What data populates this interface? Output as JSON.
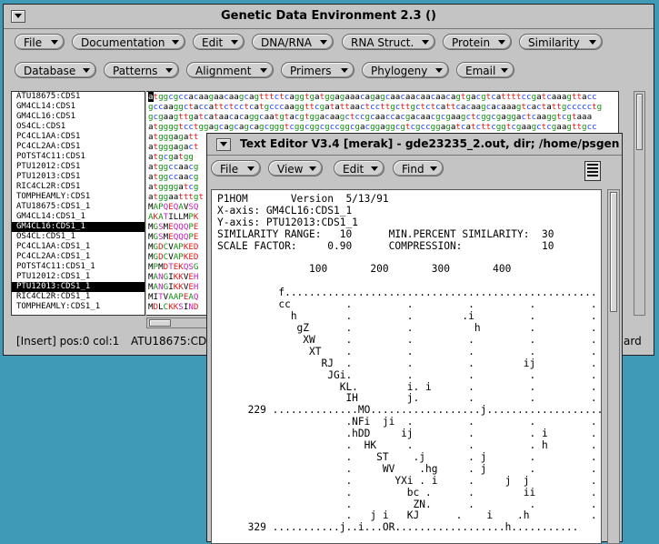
{
  "main_window": {
    "title": "Genetic Data Environment 2.3 ()",
    "menu_row1": [
      "File",
      "Documentation",
      "Edit",
      "DNA/RNA",
      "RNA Struct.",
      "Protein",
      "Similarity"
    ],
    "menu_row2": [
      "Database",
      "Patterns",
      "Alignment",
      "Primers",
      "Phylogeny",
      "Email"
    ],
    "sequence_names": [
      "ATU18675:CDS1",
      "GM4CL14:CDS1",
      "GM4CL16:CDS1",
      "OS4CL:CDS1",
      "PC4CL1AA:CDS1",
      "PC4CL2AA:CDS1",
      "POTST4C11:CDS1",
      "PTU12012:CDS1",
      "PTU12013:CDS1",
      "RIC4CL2R:CDS1",
      "TOMPHEAMLY:CDS1",
      "ATU18675:CDS1_1",
      "GM4CL14:CDS1_1",
      "GM4CL16:CDS1_1",
      "OS4CL:CDS1_1",
      "PC4CL1AA:CDS1_1",
      "PC4CL2AA:CDS1_1",
      "POTST4C11:CDS1_1",
      "PTU12012:CDS1_1",
      "PTU12013:CDS1_1",
      "RIC4CL2R:CDS1_1",
      "TOMPHEAMLY:CDS1_1"
    ],
    "selected_indices": [
      13,
      19
    ],
    "sequences": [
      "atggcgccacaagaacaagcagtttctcaggtgatggagaaacagagcaacaacaacaacagtgacgtcattttccgatcaaagttacc",
      "gccaaggctaccattctcctcatgcccaaggttcgatattaactccttgcttgctctcattcacaagcacaaagtcactattgccccctg",
      "gcgaagttgatcataacacaggcaatgtacgtggacaagctccgcaaccacgacaacgcgaagctcggcgaggactcaaggtcgtaaa",
      "atggggtcctggagcagcagcagcgggtcggcggcgccggcgacggaggcgtcgccggagatcatcttcggtcgaagctcgaagttgcc",
      "atgggagatt",
      "atgggagact",
      "atgcgatgg",
      "atggccaacg",
      "atggccaacg",
      "atggggatcg",
      "atggaatttgt",
      "MAPQEQAVSQ",
      "AKATILLMPK",
      "MGSMEQQQPE",
      "MGSMEQQQPE",
      "MGDCVAPKED",
      "MGDCVAPKED",
      "MPMDTEKQSG",
      "MANGIKKVEH",
      "MANGIKKVEH",
      "MITVAAPEAQ",
      "MDLCKKSIND"
    ],
    "status_left": "[Insert] pos:0 col:1",
    "status_seq": "ATU18675:CD",
    "status_right": "ard"
  },
  "colors": {
    "desktop": "#3f9ab8",
    "a": "#000000",
    "c": "#1a3cff",
    "g": "#109010",
    "t": "#e01818",
    "protein_red": "#e01818",
    "protein_purple": "#c020c0",
    "protein_green": "#109010",
    "protein_black": "#000000"
  },
  "editor": {
    "title": "Text Editor V3.4 [merak]  - gde23235_2.out, dir; /home/psgen",
    "menus": [
      "File",
      "View",
      "Edit",
      "Find"
    ],
    "lines": [
      "P1HOM       Version  5/13/91",
      "X-axis: GM4CL16:CDS1_1",
      "Y-axis: PTU12013:CDS1_1",
      "SIMILARITY RANGE:   10      MIN.PERCENT SIMILARITY:  30",
      "SCALE FACTOR:     0.90      COMPRESSION:             10",
      "",
      "               100       200       300       400",
      "",
      "          f...................................................",
      "          cc         .         .         .         .         .",
      "            h        .         .        .i         .         .",
      "             gZ      .         .          h        .         .",
      "              XW     .         .         .         .         .",
      "               XT    .         .         .         .         .",
      "                 RJ  .         .         .        ij         .",
      "                  JGi.         .         .         .         .",
      "                    KL.        i. i      .         .         .",
      "                     IH        j.        .         .         .",
      "     229 ..............MO..................j.......................",
      "                     .NFi  ji  .         .         .         .",
      "                     .hDD     ij         .         . i       .",
      "                     .  HK     .         .         . h       .",
      "                     .    ST    .j       . j       .         .",
      "                     .     WV    .hg     . j       .         .",
      "                     .       YXi . i     .     j  j          .",
      "                     .         bc .      .        ii         .",
      "                     .          ZN.      .         .         .",
      "                     .   j i   KJ      .    i    .h          .",
      "     329 ...........j..i...OR..................h..........."
    ]
  }
}
